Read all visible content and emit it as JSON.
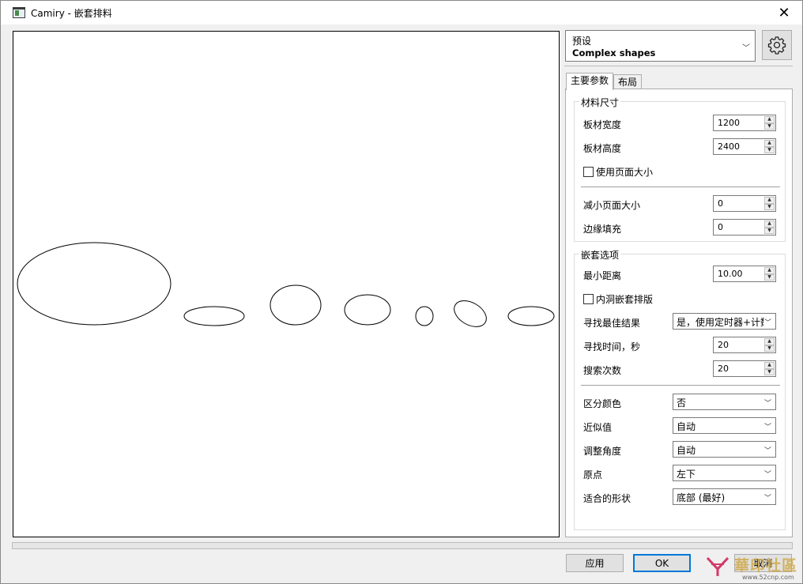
{
  "window": {
    "title": "Camiry - 嵌套排料",
    "close_glyph": "✕"
  },
  "preset": {
    "label": "预设",
    "value": "Complex shapes",
    "icon": "chevron-down-icon"
  },
  "settings": {
    "icon": "gear-icon"
  },
  "tabs": [
    {
      "label": "主要参数",
      "active": true
    },
    {
      "label": "布局",
      "active": false
    }
  ],
  "material": {
    "title": "材料尺寸",
    "sheet_width": {
      "label": "板材宽度",
      "value": "1200"
    },
    "sheet_height": {
      "label": "板材高度",
      "value": "2400"
    },
    "use_page_size": {
      "label": "使用页面大小",
      "checked": false
    },
    "reduce_page_size": {
      "label": "减小页面大小",
      "value": "0"
    },
    "edge_padding": {
      "label": "边缘填充",
      "value": "0"
    }
  },
  "nesting": {
    "title": "嵌套选项",
    "min_distance": {
      "label": "最小距离",
      "value": "10.00"
    },
    "hole_nesting": {
      "label": "内洞嵌套排版",
      "checked": false
    },
    "best_result": {
      "label": "寻找最佳结果",
      "value": "是，使用定时器+计数"
    },
    "search_time": {
      "label": "寻找时间，秒",
      "value": "20"
    },
    "search_count": {
      "label": "搜索次数",
      "value": "20"
    },
    "distinguish_color": {
      "label": "区分颜色",
      "value": "否"
    },
    "approximation": {
      "label": "近似值",
      "value": "自动"
    },
    "adjust_angle": {
      "label": "调整角度",
      "value": "自动"
    },
    "origin": {
      "label": "原点",
      "value": "左下"
    },
    "fit_shape": {
      "label": "适合的形状",
      "value": "底部 (最好)"
    }
  },
  "buttons": {
    "apply": "应用",
    "ok": "OK",
    "cancel": "取消"
  },
  "watermark": {
    "text": "華印社區",
    "url": "www.52cnp.com"
  }
}
